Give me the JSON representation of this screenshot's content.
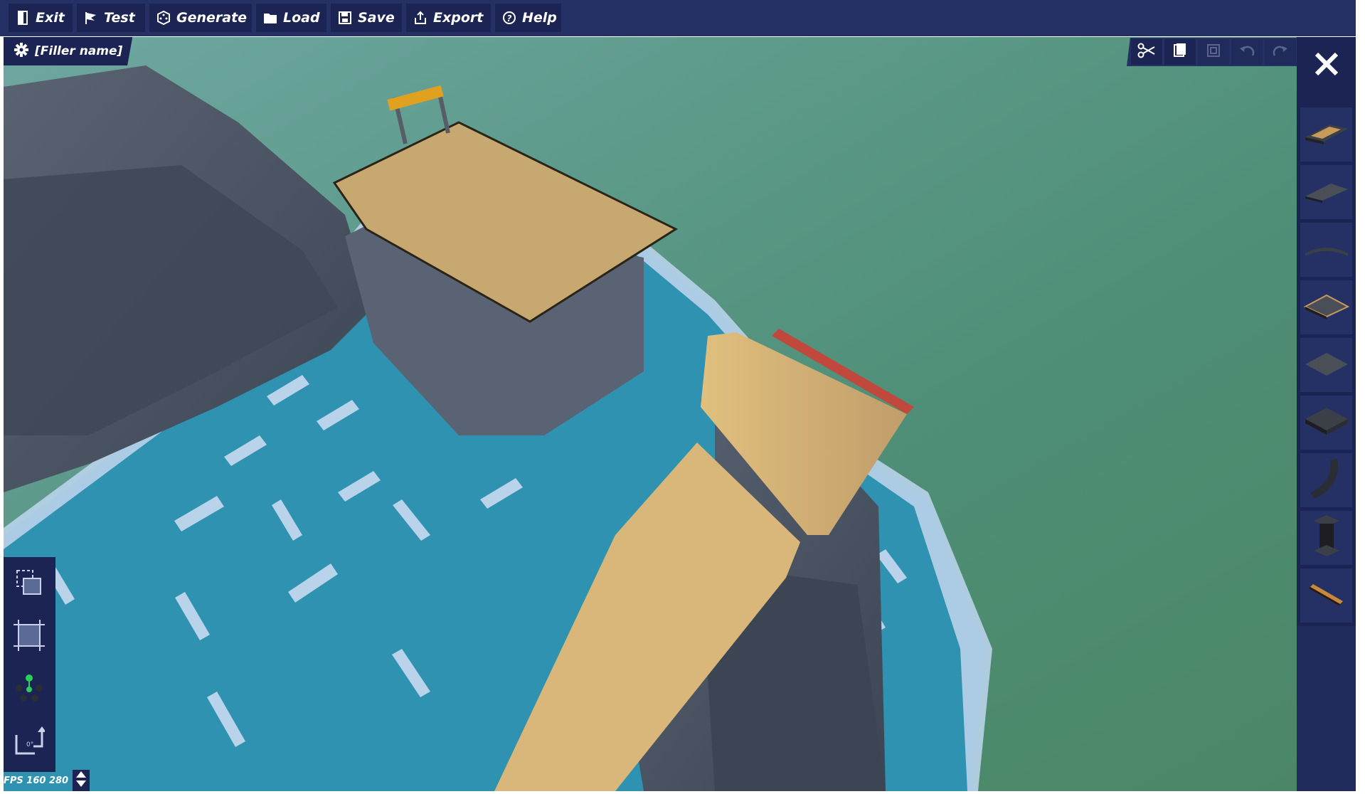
{
  "menu": {
    "items": [
      {
        "label": "Exit",
        "icon": "door-exit-icon"
      },
      {
        "label": "Test",
        "icon": "flag-icon"
      },
      {
        "label": "Generate",
        "icon": "dice-icon"
      },
      {
        "label": "Load",
        "icon": "folder-icon"
      },
      {
        "label": "Save",
        "icon": "floppy-disk-icon"
      },
      {
        "label": "Export",
        "icon": "export-icon"
      },
      {
        "label": "Help",
        "icon": "question-circle-icon"
      }
    ]
  },
  "filler": {
    "name": "[Filler name]",
    "icon": "gear-icon"
  },
  "edit_toolbar": {
    "buttons": [
      {
        "icon": "scissors-icon",
        "enabled": true
      },
      {
        "icon": "copy-icon",
        "enabled": true
      },
      {
        "icon": "paste-icon",
        "enabled": false
      },
      {
        "icon": "undo-icon",
        "enabled": false
      },
      {
        "icon": "redo-icon",
        "enabled": false
      }
    ]
  },
  "right_panel": {
    "close_icon": "close-icon",
    "blocks": [
      "road-block-icon",
      "road-slope-icon",
      "curve-block-icon",
      "platform-block-icon",
      "flat-block-icon",
      "dark-block-icon",
      "ramp-curve-icon",
      "pillar-block-icon",
      "barrier-strip-icon"
    ]
  },
  "left_toolbar": {
    "buttons": [
      "select-copy-icon",
      "select-area-icon",
      "move-gizmo-icon",
      "rotate-icon"
    ]
  },
  "status": {
    "fps_text": "FPS 160  280",
    "stepper_icon": "up-down-arrows-icon"
  },
  "colors": {
    "menu_bg": "#253064",
    "button_bg": "#1b2452",
    "sky": "#5a9a8a",
    "water": "#2e92b0",
    "sand": "#c9a974",
    "rock": "#4a5464"
  }
}
